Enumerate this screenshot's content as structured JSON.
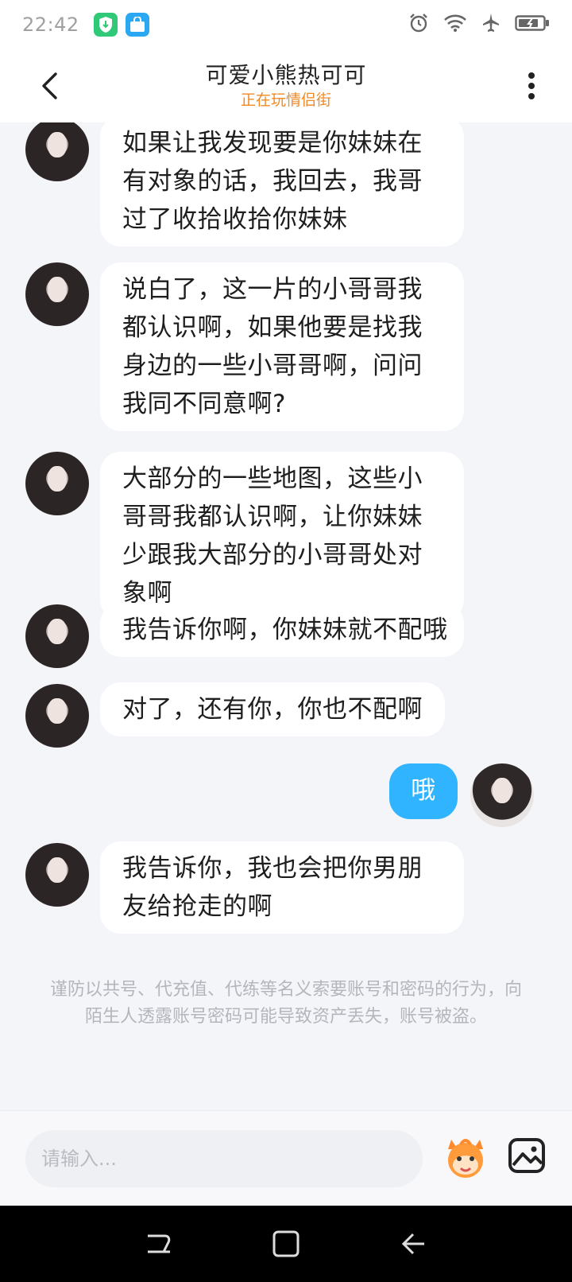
{
  "status_bar": {
    "time": "22:42"
  },
  "header": {
    "title": "可爱小熊热可可",
    "subtitle": "正在玩情侣街"
  },
  "messages": [
    {
      "sender": "other",
      "text": "如果让我发现要是你妹妹在有对象的话，我回去，我哥过了收拾收拾你妹妹"
    },
    {
      "sender": "other",
      "text": "说白了，这一片的小哥哥我都认识啊，如果他要是找我身边的一些小哥哥啊，问问我同不同意啊?"
    },
    {
      "sender": "other",
      "text": "大部分的一些地图，这些小哥哥我都认识啊，让你妹妹少跟我大部分的小哥哥处对象啊"
    },
    {
      "sender": "other",
      "text": "我告诉你啊，你妹妹就不配哦"
    },
    {
      "sender": "other",
      "text": "对了，还有你，你也不配啊"
    },
    {
      "sender": "me",
      "text": "哦"
    },
    {
      "sender": "other",
      "text": "我告诉你，我也会把你男朋友给抢走的啊"
    }
  ],
  "notice": "谨防以共号、代充值、代练等名义索要账号和密码的行为，向陌生人透露账号密码可能导致资产丢失，账号被盗。",
  "input": {
    "placeholder": "请输入..."
  },
  "colors": {
    "accent": "#31b4ff",
    "subtitle": "#f08a26",
    "bubble_other": "#ffffff"
  }
}
